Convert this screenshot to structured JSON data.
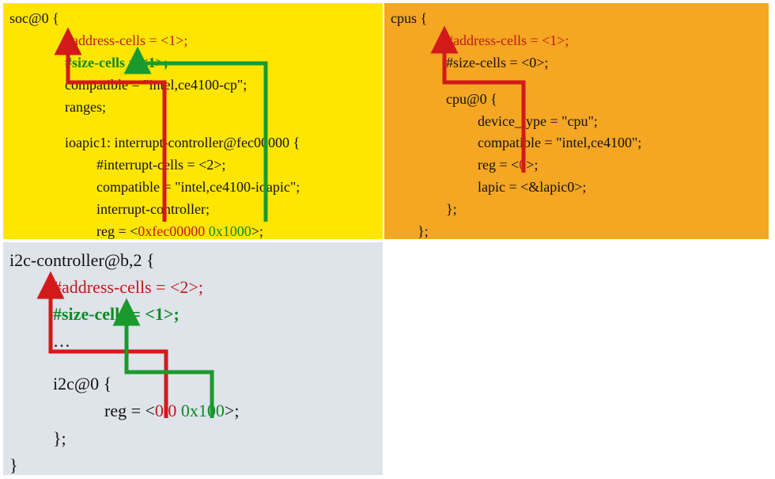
{
  "panels": {
    "yellow": {
      "header": "soc@0 {",
      "addr_cells": "#address-cells = <1>;",
      "size_cells": "#size-cells = <1>;",
      "compatible": "compatible = \"intel,ce4100-cp\";",
      "ranges": "ranges;",
      "ioapic_hdr": "ioapic1: interrupt-controller@fec00000 {",
      "int_cells": "#interrupt-cells = <2>;",
      "ioapic_compat": "compatible = \"intel,ce4100-ioapic\";",
      "int_ctrl": "interrupt-controller;",
      "reg_prefix": "reg = <",
      "reg_addr": "0xfec00000",
      "reg_size": "0x1000",
      "reg_suffix": ">;",
      "close": "};"
    },
    "orange": {
      "header": "cpus {",
      "addr_cells": "#address-cells = <1>;",
      "size_cells": "#size-cells = <0>;",
      "cpu_hdr": "cpu@0 {",
      "dev_type": "device_type = \"cpu\";",
      "compatible": "compatible = \"intel,ce4100\";",
      "reg_prefix": "reg = <",
      "reg_val": "0",
      "reg_suffix": ">;",
      "lapic": "lapic = <&lapic0>;",
      "close_inner": "};",
      "close_outer": "};"
    },
    "grey": {
      "header": "i2c-controller@b,2 {",
      "addr_cells": "#address-cells = <2>;",
      "size_cells": "#size-cells = <1>;",
      "ellipsis": "…",
      "i2c_hdr": "i2c@0 {",
      "reg_prefix": "reg = <",
      "reg_a": "0",
      "reg_b": "0",
      "reg_c": "0x100",
      "reg_suffix": ">;",
      "close_inner": "};",
      "close_outer": "}"
    }
  },
  "colors": {
    "red_arrow": "#d21a1a",
    "green_arrow": "#1a9a2d"
  }
}
